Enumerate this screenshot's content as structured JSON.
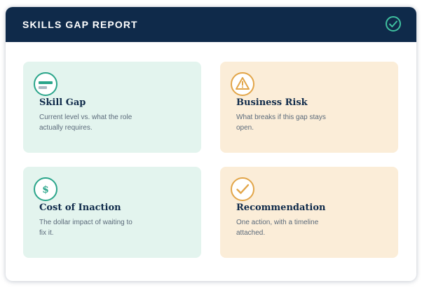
{
  "header": {
    "title": "SKILLS GAP REPORT",
    "status_icon": "check-circle-icon",
    "background_color": "#0f2a4a"
  },
  "cards": [
    {
      "title": "Skill Gap",
      "description": "Current level vs. what the role actually requires.",
      "icon": "bars-icon",
      "background_color": "#e3f4ee",
      "accent_color": "#2aa58a"
    },
    {
      "title": "Business Risk",
      "description": "What breaks if this gap stays open.",
      "icon": "warning-icon",
      "background_color": "#fbedd8",
      "accent_color": "#e2a548"
    },
    {
      "title": "Cost of Inaction",
      "description": "The dollar impact of waiting to fix it.",
      "icon": "dollar-icon",
      "icon_text": "$",
      "background_color": "#e3f4ee",
      "accent_color": "#2aa58a"
    },
    {
      "title": "Recommendation",
      "description": "One action, with a timeline attached.",
      "icon": "checkmark-icon",
      "background_color": "#fbedd8",
      "accent_color": "#e2a548"
    }
  ]
}
